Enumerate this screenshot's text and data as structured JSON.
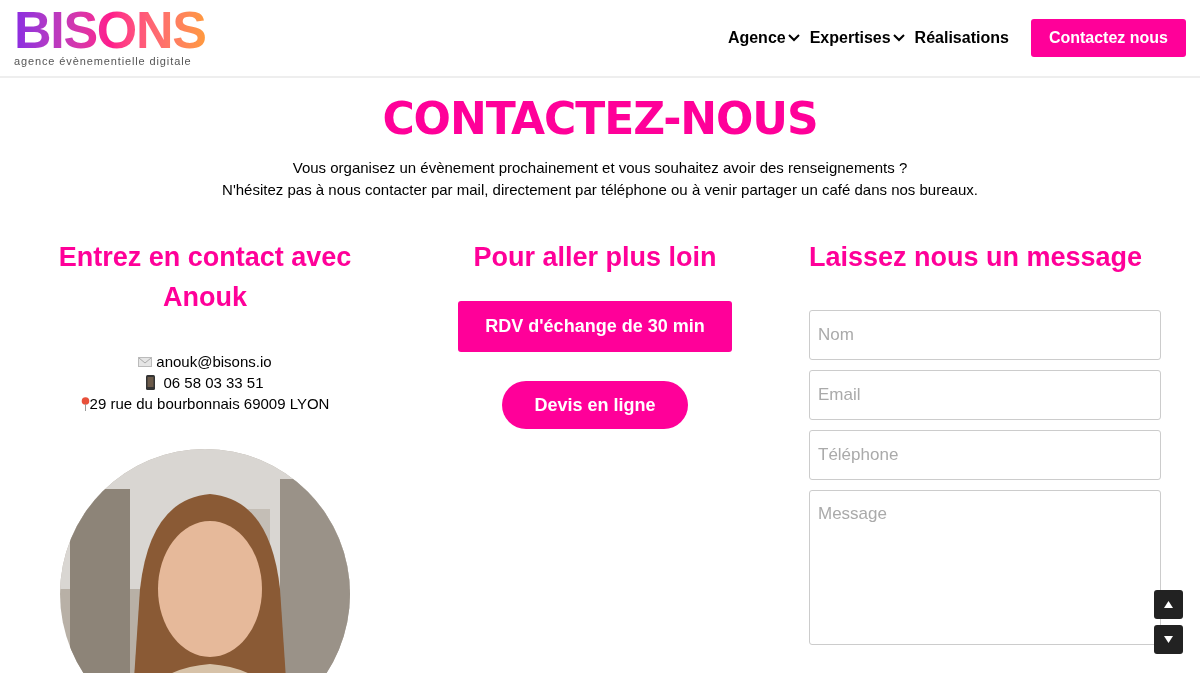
{
  "header": {
    "logo": {
      "name": "BISONS",
      "tagline": "agence évènementielle digitale"
    },
    "nav": [
      {
        "label": "Agence",
        "dropdown": true
      },
      {
        "label": "Expertises",
        "dropdown": true
      },
      {
        "label": "Réalisations",
        "dropdown": false
      }
    ],
    "cta": "Contactez nous"
  },
  "title": "CONTACTEZ-NOUS",
  "intro": [
    "Vous organisez un évènement prochainement et vous souhaitez avoir des renseignements ?",
    "N'hésitez pas à nous contacter par mail, directement par téléphone ou à venir partager un café dans nos bureaux."
  ],
  "contact": {
    "heading": "Entrez en contact avec Anouk",
    "lines": [
      {
        "kind": "email",
        "text": "anouk@bisons.io"
      },
      {
        "kind": "phone",
        "text": "06 58 03 33 51"
      },
      {
        "kind": "address",
        "text": "29 rue du bourbonnais 69009 LYON"
      }
    ]
  },
  "more": {
    "heading": "Pour aller plus loin",
    "buttons": [
      {
        "kind": "square",
        "label": "RDV d'échange de 30 min"
      },
      {
        "kind": "pill",
        "label": "Devis en ligne"
      }
    ]
  },
  "form": {
    "heading": "Laissez nous un message",
    "fields": [
      {
        "kind": "input",
        "placeholder": "Nom"
      },
      {
        "kind": "input",
        "placeholder": "Email"
      },
      {
        "kind": "input",
        "placeholder": "Téléphone"
      },
      {
        "kind": "textarea",
        "placeholder": "Message"
      }
    ]
  }
}
